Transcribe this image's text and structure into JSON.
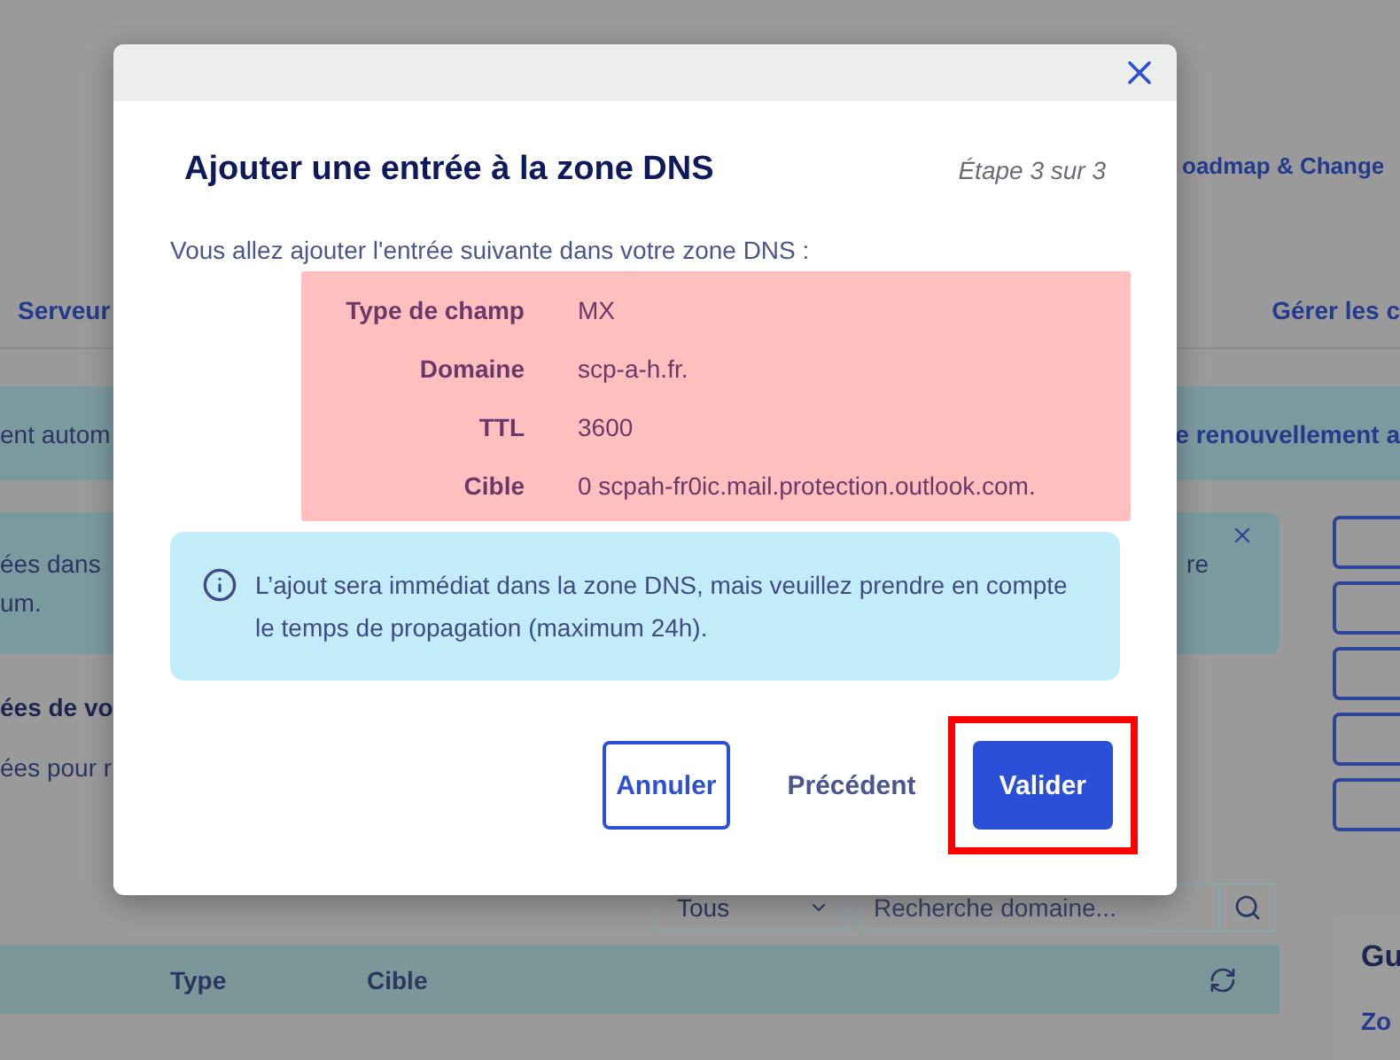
{
  "background": {
    "nav_link": "oadmap & Change",
    "tabs": [
      "Serveur",
      "Gérer les c"
    ],
    "banner": {
      "left": "ent autom",
      "right": "e renouvellement a"
    },
    "alert": {
      "lines": [
        "ées dans",
        "um."
      ],
      "right": "re"
    },
    "section_title": "ées de vo",
    "section_text": "ées pour r",
    "filter": {
      "select": "Tous",
      "search_placeholder": "Recherche domaine..."
    },
    "table": {
      "columns": [
        "Type",
        "Cible"
      ]
    },
    "side_card": {
      "title": "Gu",
      "link": "Zo"
    }
  },
  "dialog": {
    "title": "Ajouter une entrée à la zone DNS",
    "step": "Étape 3 sur 3",
    "intro": "Vous allez ajouter l'entrée suivante dans votre zone DNS :",
    "fields": [
      {
        "label": "Type de champ",
        "value": "MX"
      },
      {
        "label": "Domaine",
        "value": "scp-a-h.fr."
      },
      {
        "label": "TTL",
        "value": "3600"
      },
      {
        "label": "Cible",
        "value": "0 scpah-fr0ic.mail.protection.outlook.com."
      }
    ],
    "info": "L’ajout sera immédiat dans la zone DNS, mais veuillez prendre en compte le temps de propagation (maximum 24h).",
    "buttons": [
      {
        "label": "Annuler",
        "kind": "outline",
        "highlighted": false
      },
      {
        "label": "Précédent",
        "kind": "text",
        "highlighted": false
      },
      {
        "label": "Valider",
        "kind": "primary",
        "highlighted": true
      }
    ]
  }
}
